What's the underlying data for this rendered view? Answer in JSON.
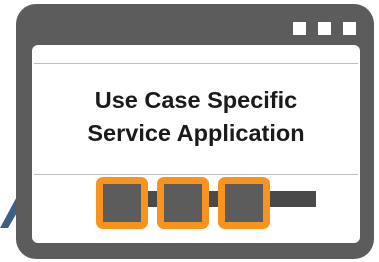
{
  "title": {
    "line1": "Use Case Specific",
    "line2": "Service Application"
  },
  "colors": {
    "frame": "#5c5c5c",
    "accent": "#f7931e",
    "pointer": "#3e5f86"
  },
  "components": [
    "component-1",
    "component-2",
    "component-3"
  ]
}
